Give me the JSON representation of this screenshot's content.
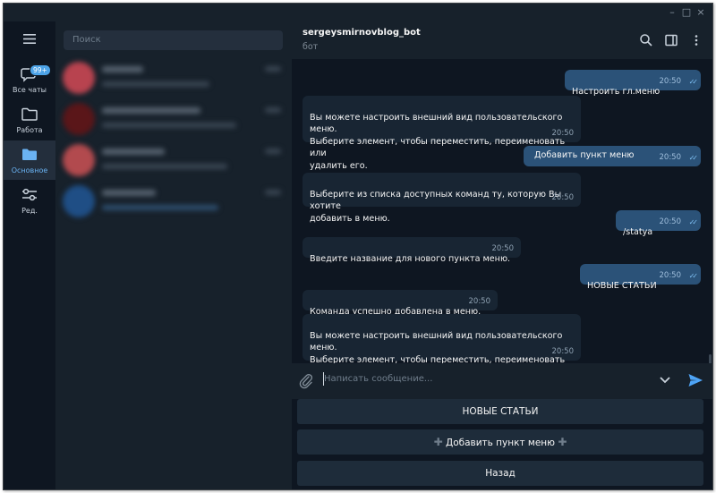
{
  "window": {
    "controls": [
      "–",
      "□",
      "×"
    ]
  },
  "rail": {
    "items": [
      {
        "label": "Все чаты",
        "icon": "chat-bubbles-icon",
        "badge": "99+",
        "active": false
      },
      {
        "label": "Работа",
        "icon": "folder-icon",
        "active": false
      },
      {
        "label": "Основное",
        "icon": "folder-icon",
        "active": true
      },
      {
        "label": "Ред.",
        "icon": "edit-filters-icon",
        "active": false
      }
    ]
  },
  "chat_list": {
    "search_placeholder": "Поиск",
    "avatar_colors": [
      "#b8434f",
      "#5a1619",
      "#b24a4e",
      "#1f4e85"
    ]
  },
  "chat": {
    "title": "sergeysmirnovblog_bot",
    "subtitle": "бот",
    "messages": [
      {
        "dir": "out",
        "text": "Настроить гл.меню",
        "time": "20:50"
      },
      {
        "dir": "in",
        "text": "Вы можете настроить внешний вид пользовательского меню.\nВыберите элемент, чтобы переместить, переименовать или\nудалить его.",
        "time": "20:50"
      },
      {
        "dir": "out",
        "text": "Добавить пункт меню",
        "time": "20:50"
      },
      {
        "dir": "in",
        "text": "Выберите из списка доступных команд ту, которую Вы хотите\nдобавить в меню.",
        "time": "20:50"
      },
      {
        "dir": "out",
        "text": "/statya",
        "time": "20:50"
      },
      {
        "dir": "in",
        "text": "Введите название для нового пункта меню.",
        "time": "20:50"
      },
      {
        "dir": "out",
        "text": "НОВЫЕ СТАТЬИ",
        "time": "20:50"
      },
      {
        "dir": "in",
        "text": "Команда успешно добавлена в меню.",
        "time": "20:50"
      },
      {
        "dir": "in",
        "text": "Вы можете настроить внешний вид пользовательского меню.\nВыберите элемент, чтобы переместить, переименовать или\nудалить его.",
        "time": "20:50"
      }
    ],
    "composer_placeholder": "Написать сообщение...",
    "keyboard": [
      "НОВЫЕ СТАТЬИ",
      "Добавить пункт меню",
      "Назад"
    ]
  },
  "colors": {
    "accent": "#6ab2f2",
    "outgoing_bubble": "#2b5278",
    "incoming_bubble": "#182533"
  }
}
